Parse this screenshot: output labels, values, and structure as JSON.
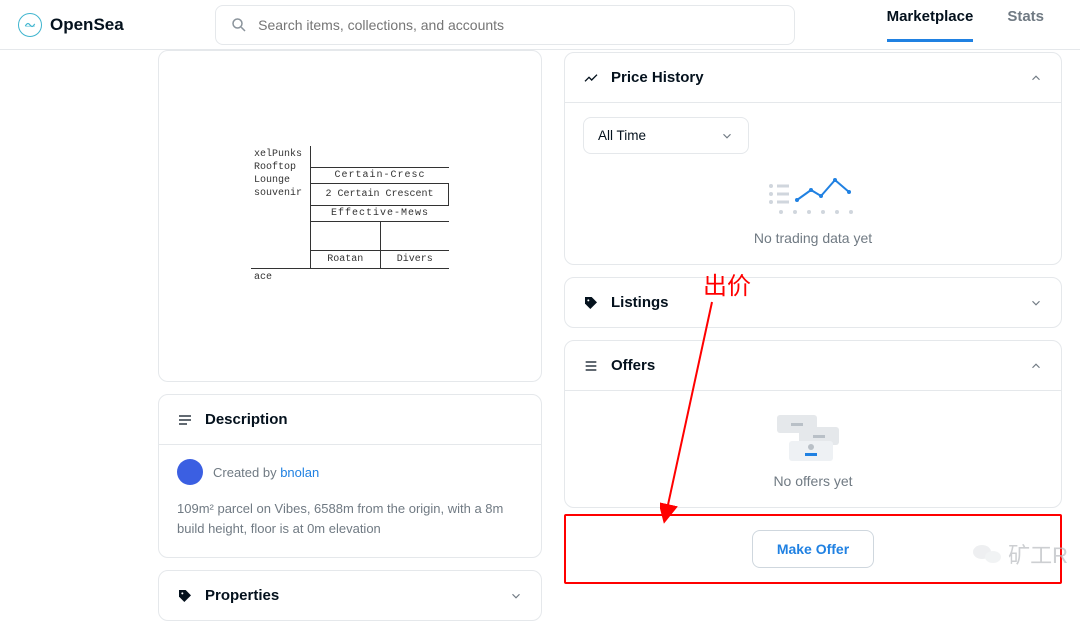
{
  "brand": {
    "name": "OpenSea"
  },
  "search": {
    "placeholder": "Search items, collections, and accounts"
  },
  "nav": {
    "marketplace": "Marketplace",
    "stats": "Stats"
  },
  "nft_preview": {
    "cells": [
      "xelPunks",
      "Rooftop",
      "Lounge",
      "souvenir",
      "ace",
      "Certain-Cresc",
      "2 Certain Crescent",
      "Effective-Mews",
      "Roatan",
      "Divers"
    ]
  },
  "description": {
    "title": "Description",
    "created_by_prefix": "Created by ",
    "creator": "bnolan",
    "body": "109m² parcel on Vibes, 6588m from the origin, with a 8m build height, floor is at 0m elevation"
  },
  "properties": {
    "title": "Properties"
  },
  "price_history": {
    "title": "Price History",
    "time_filter": "All Time",
    "empty": "No trading data yet"
  },
  "listings": {
    "title": "Listings"
  },
  "offers": {
    "title": "Offers",
    "empty": "No offers yet",
    "button": "Make Offer"
  },
  "annotation": {
    "label": "出价"
  },
  "watermark": {
    "text": "矿工R"
  }
}
